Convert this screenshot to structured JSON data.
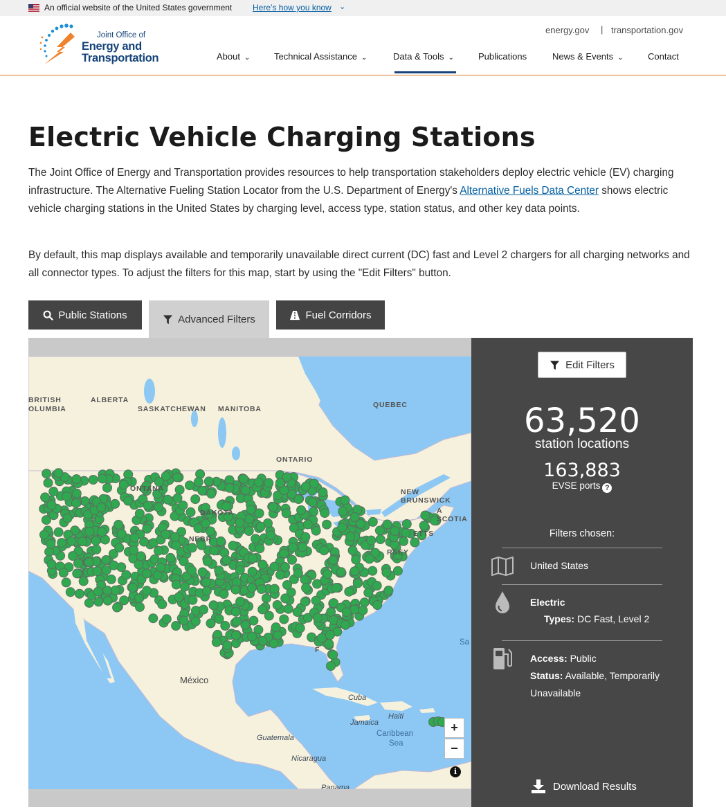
{
  "gov_banner": {
    "text": "An official website of the United States government",
    "link": "Here’s how you know"
  },
  "header": {
    "logo_line1": "Joint Office of",
    "logo_line2": "Energy and",
    "logo_line3": "Transportation",
    "utility_links": [
      "energy.gov",
      "transportation.gov"
    ],
    "nav": [
      {
        "label": "About",
        "has_menu": true
      },
      {
        "label": "Technical Assistance",
        "has_menu": true
      },
      {
        "label": "Data & Tools",
        "has_menu": true,
        "active": true
      },
      {
        "label": "Publications",
        "has_menu": false
      },
      {
        "label": "News & Events",
        "has_menu": true
      },
      {
        "label": "Contact",
        "has_menu": false
      }
    ]
  },
  "page": {
    "title": "Electric Vehicle Charging Stations",
    "para1_a": "The Joint Office of Energy and Transportation provides resources to help transportation stakeholders deploy electric vehicle (EV) charging infrastructure. The Alternative Fueling Station Locator from the U.S. Department of Energy's ",
    "para1_link": "Alternative Fuels Data Center",
    "para1_b": " shows electric vehicle charging stations in the United States by charging level, access type, station status, and other key data points.",
    "para2": "By default, this map displays available and temporarily unavailable direct current (DC) fast and Level 2 chargers for all charging networks and all connector types. To adjust the filters for this map, start by using the \"Edit Filters\" button."
  },
  "tabs": [
    {
      "label": "Public Stations",
      "icon": "search-icon",
      "active": false
    },
    {
      "label": "Advanced Filters",
      "icon": "filter-icon",
      "active": true
    },
    {
      "label": "Fuel Corridors",
      "icon": "road-icon",
      "active": false
    }
  ],
  "map": {
    "labels": {
      "british_columbia_a": "BRITISH",
      "british_columbia_b": "OLUMBIA",
      "alberta": "ALBERTA",
      "saskatchewan": "SASKATCHEWAN",
      "manitoba": "MANITOBA",
      "quebec": "QUEBEC",
      "ontario": "ONTARIO",
      "montana": "ONTANA",
      "new_brunswick": "NEW BRUNSWICK",
      "nova_scotia": "A SCOTIA",
      "dakota": "DAKOTA",
      "massachusetts": "ETTS",
      "jersey": "RSEY",
      "nebraska": "NEBR",
      "florida": "F",
      "mexico": "México",
      "cuba": "Cuba",
      "haiti": "Haiti",
      "jamaica": "Jamaica",
      "caribbean": "Caribbean",
      "sea": "Sea",
      "guatemala": "Guatemala",
      "nicaragua": "Nicaragua",
      "panama": "Panama",
      "san": "Sa"
    },
    "zoom_in": "+",
    "zoom_out": "−",
    "info": "i",
    "marker_color": "#2fa84f"
  },
  "panel": {
    "edit_filters": "Edit Filters",
    "station_count": "63,520",
    "station_label": "station locations",
    "evse_count": "163,883",
    "evse_label": "EVSE ports",
    "filters_title": "Filters chosen:",
    "location": "United States",
    "fuel": "Electric",
    "types_label": "Types:",
    "types_value": "DC Fast, Level 2",
    "access_label": "Access:",
    "access_value": "Public",
    "status_label": "Status:",
    "status_value_1": "Available, Temporarily",
    "status_value_2": "Unavailable",
    "download": "Download Results"
  },
  "colors": {
    "brand_blue": "#15437a",
    "accent_orange": "#f0822d",
    "link": "#005ea2",
    "panel_bg": "#474747",
    "tab_dark": "#444444"
  }
}
